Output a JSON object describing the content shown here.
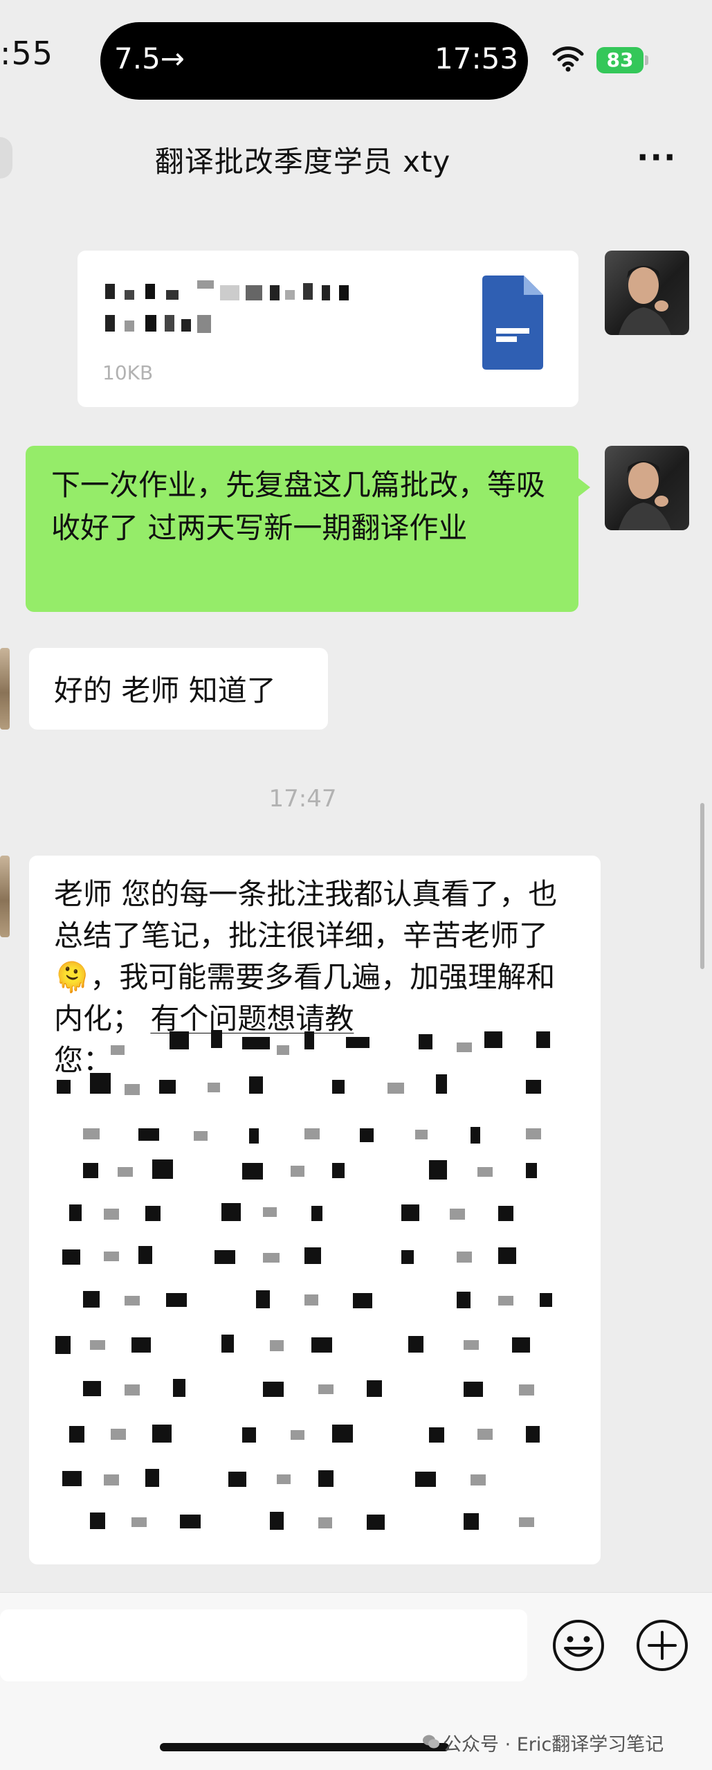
{
  "status": {
    "left_time": ":55",
    "island_left": "7.5→",
    "island_time": "17:53",
    "battery": "83"
  },
  "nav": {
    "title": "翻译批改季度学员 xty",
    "more_label": "···"
  },
  "file_message": {
    "size_label": "10KB"
  },
  "messages": [
    {
      "text": "下一次作业，先复盘这几篇批改，等吸收好了 过两天写新一期翻译作业"
    },
    {
      "text": "好的 老师 知道了"
    }
  ],
  "timestamp": "17:47",
  "long_message": {
    "part1": "老师 您的每一条批注我都认真看了，也总结了笔记，批注很详细，辛苦老师了",
    "emoji": "🫠",
    "part2": "，我可能需要多看几遍，加强理解和内化；",
    "underlined": "有个问题想请教",
    "part3": "您："
  },
  "watermark": "公众号 · Eric翻译学习笔记",
  "colors": {
    "green_bubble": "#95ec69",
    "battery": "#34c759",
    "file_icon": "#2f5fb3"
  },
  "icons": [
    "wifi-icon",
    "document-icon",
    "emoji-icon",
    "plus-icon"
  ]
}
